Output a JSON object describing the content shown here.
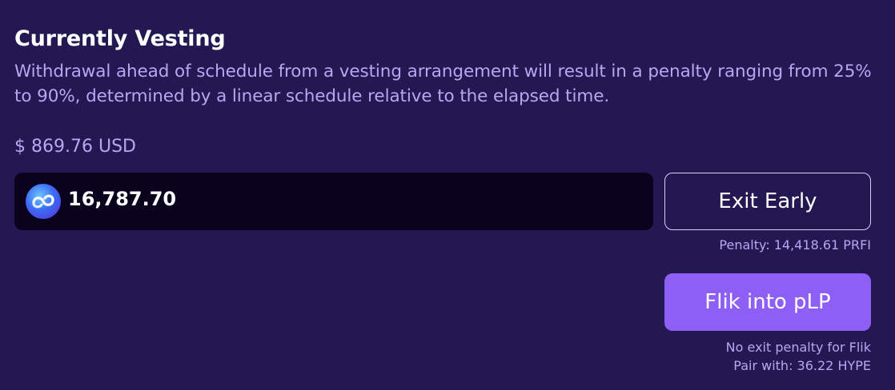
{
  "vesting": {
    "title": "Currently Vesting",
    "description": "Withdrawal ahead of schedule from a vesting arrangement will result in a penalty ranging from 25% to 90%, determined by a linear schedule relative to the elapsed time.",
    "usd_value": "$ 869.76 USD",
    "amount": "16,787.70",
    "token_icon": "token-logo-icon"
  },
  "actions": {
    "exit_label": "Exit Early",
    "penalty_text": "Penalty: 14,418.61 PRFI",
    "flik_label": "Flik into pLP",
    "no_penalty_text": "No exit penalty for Flik",
    "pair_text": "Pair with: 36.22 HYPE"
  },
  "colors": {
    "background": "#231852",
    "input_background": "#0a031e",
    "muted_text": "#b9a6f2",
    "primary_button": "#8e5ff4"
  }
}
